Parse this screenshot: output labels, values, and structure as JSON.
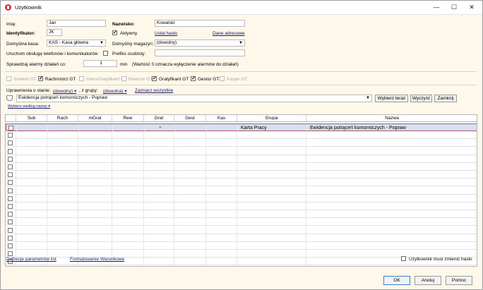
{
  "window": {
    "title": "Użytkownik",
    "minimize": "—",
    "maximize": "☐",
    "close": "✕"
  },
  "form": {
    "imie_label": "Imię:",
    "imie_value": "Jan",
    "nazwisko_label": "Nazwisko:",
    "nazwisko_value": "Kowalski",
    "identyfikator_label": "Identyfikator:",
    "identyfikator_value": "JK",
    "aktywny_label": "Aktywny",
    "aktywny_checked": true,
    "ustal_haslo": "Ustal hasło",
    "dane_adresowe": "Dane adresowe",
    "kasa_label": "Domyślna kasa:",
    "kasa_value": "KAS - Kasa główna",
    "magazyn_label": "Domyślny magazyn:",
    "magazyn_value": "(dowolny)",
    "uruchom_label": "Uruchom obsługę telefonów i komunikatorów",
    "prefiks_label": "Prefiks osobisty:",
    "prefiks_value": "",
    "alarmy_label": "Sprawdzaj alarmy działań co:",
    "alarmy_value": "1",
    "alarmy_unit": "min",
    "alarmy_note": "(Wartość 0 oznacza wyłączenie alarmów do działań)"
  },
  "roles": [
    {
      "label": "Subiekt GT",
      "checked": false,
      "disabled": true
    },
    {
      "label": "Rachmistrz GT",
      "checked": true,
      "disabled": false
    },
    {
      "label": "mikroGratyfikant GT",
      "checked": false,
      "disabled": true
    },
    {
      "label": "Rewizor GT",
      "checked": false,
      "disabled": true
    },
    {
      "label": "Gratyfikant GT",
      "checked": true,
      "disabled": false
    },
    {
      "label": "Gestor GT",
      "checked": true,
      "disabled": false
    },
    {
      "label": "Kasjer GT",
      "checked": false,
      "disabled": true
    }
  ],
  "filter": {
    "uprawnienia_label": "Uprawnienia o stanie:",
    "stan_value": "(dowolny)",
    "grupy_label": ", z grupy:",
    "grupa_value": "(dowolna)",
    "zaznacz": "Zaznacz wszystkie",
    "search_value": "Ewidencja potrąceń komorniczych - Popraw",
    "wybierz_btn": "Wybierz teraz",
    "wyczysc_btn": "Wyczyść",
    "zamknij_btn": "Zamknij",
    "sort_label": "Wybierz według nazwy"
  },
  "grid": {
    "columns": [
      "Sub",
      "Rach",
      "mGrat",
      "Rew",
      "Grat",
      "Gest",
      "Kas",
      "Grupa",
      "Nazwa"
    ],
    "rows": [
      {
        "grupa": "Karta Pracy",
        "nazwa": "Ewidencja potrąceń komorniczych - Popraw",
        "grat_marker": "●"
      }
    ]
  },
  "bottom": {
    "definicje": "Definicje parametrów list",
    "formatowanie": "Formatowanie Warunkowe",
    "musi_zmienic": "Użytkownik musi zmienić hasło"
  },
  "buttons": {
    "ok": "OK",
    "anuluj": "Anuluj",
    "pomoc": "Pomoc"
  }
}
